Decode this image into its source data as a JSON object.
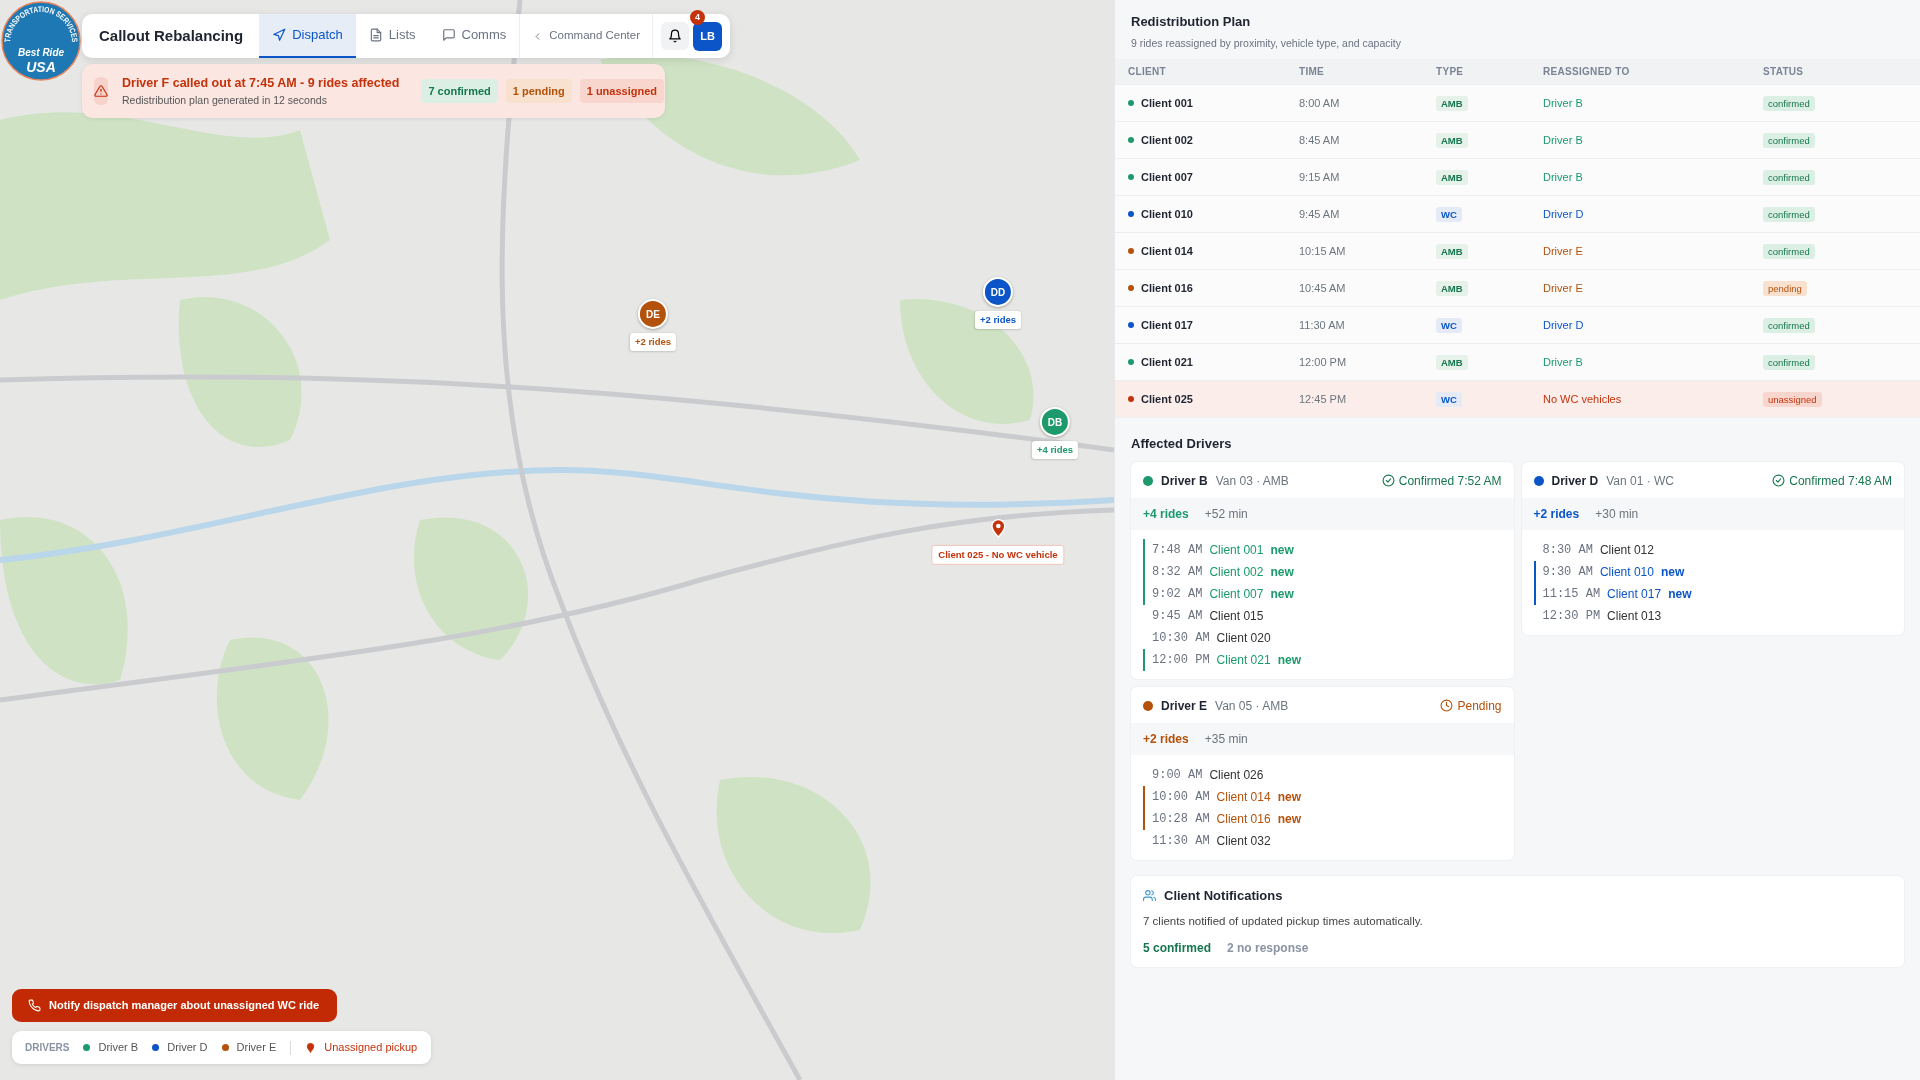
{
  "logo": {
    "arc": "TRANSPORTATION SERVICES",
    "line1": "Best Ride",
    "line2": "USA"
  },
  "header": {
    "title": "Callout Rebalancing",
    "tabs": [
      {
        "label": "Dispatch",
        "selected": true
      },
      {
        "label": "Lists",
        "selected": false
      },
      {
        "label": "Comms",
        "selected": false
      }
    ],
    "back_link": "Command Center",
    "notification_count": "4",
    "user_initials": "LB"
  },
  "alert": {
    "title": "Driver F called out at 7:45 AM - 9 rides affected",
    "subtitle": "Redistribution plan generated in 12 seconds",
    "badges": [
      {
        "label": "7 confirmed",
        "kind": "confirmed"
      },
      {
        "label": "1 pending",
        "kind": "pending"
      },
      {
        "label": "1 unassigned",
        "kind": "unassigned"
      }
    ]
  },
  "map": {
    "drivers": [
      {
        "initials": "DE",
        "label": "+2 rides",
        "color": "#b4510b"
      },
      {
        "initials": "DD",
        "label": "+2 rides",
        "color": "#0b55c9"
      },
      {
        "initials": "DB",
        "label": "+4 rides",
        "color": "#1c9a6c"
      }
    ],
    "unassigned_pin": {
      "label": "Client 025 - No WC vehicle"
    }
  },
  "notify_button": {
    "label": "Notify dispatch manager about unassigned WC ride"
  },
  "legend": {
    "title": "DRIVERS",
    "items": [
      {
        "label": "Driver B",
        "color": "#1c9a6c"
      },
      {
        "label": "Driver D",
        "color": "#0b55c9"
      },
      {
        "label": "Driver E",
        "color": "#b4510b"
      }
    ],
    "unassigned": "Unassigned pickup"
  },
  "plan": {
    "title": "Redistribution Plan",
    "subtitle": "9 rides reassigned by proximity, vehicle type, and capacity",
    "columns": [
      "CLIENT",
      "TIME",
      "TYPE",
      "REASSIGNED TO",
      "STATUS"
    ],
    "rows": [
      {
        "client": "Client 001",
        "time": "8:00 AM",
        "type": {
          "label": "AMB",
          "kind": "amb"
        },
        "reassigned_to": "Driver B",
        "status": "confirmed",
        "kind": "confirmed",
        "color": "#1c9a6c"
      },
      {
        "client": "Client 002",
        "time": "8:45 AM",
        "type": {
          "label": "AMB",
          "kind": "amb"
        },
        "reassigned_to": "Driver B",
        "status": "confirmed",
        "kind": "confirmed",
        "color": "#1c9a6c"
      },
      {
        "client": "Client 007",
        "time": "9:15 AM",
        "type": {
          "label": "AMB",
          "kind": "amb"
        },
        "reassigned_to": "Driver B",
        "status": "confirmed",
        "kind": "confirmed",
        "color": "#1c9a6c"
      },
      {
        "client": "Client 010",
        "time": "9:45 AM",
        "type": {
          "label": "WC",
          "kind": "wc"
        },
        "reassigned_to": "Driver D",
        "status": "confirmed",
        "kind": "confirmed",
        "color": "#0b55c9"
      },
      {
        "client": "Client 014",
        "time": "10:15 AM",
        "type": {
          "label": "AMB",
          "kind": "amb"
        },
        "reassigned_to": "Driver E",
        "status": "confirmed",
        "kind": "confirmed",
        "color": "#b4510b"
      },
      {
        "client": "Client 016",
        "time": "10:45 AM",
        "type": {
          "label": "AMB",
          "kind": "amb"
        },
        "reassigned_to": "Driver E",
        "status": "pending",
        "kind": "pending",
        "color": "#b4510b"
      },
      {
        "client": "Client 017",
        "time": "11:30 AM",
        "type": {
          "label": "WC",
          "kind": "wc"
        },
        "reassigned_to": "Driver D",
        "status": "confirmed",
        "kind": "confirmed",
        "color": "#0b55c9"
      },
      {
        "client": "Client 021",
        "time": "12:00 PM",
        "type": {
          "label": "AMB",
          "kind": "amb"
        },
        "reassigned_to": "Driver B",
        "status": "confirmed",
        "kind": "confirmed",
        "color": "#1c9a6c"
      },
      {
        "client": "Client 025",
        "time": "12:45 PM",
        "type": {
          "label": "WC",
          "kind": "wc"
        },
        "reassigned_to": "No WC vehicles",
        "status": "unassigned",
        "kind": "unassigned",
        "color": "#c4320c"
      }
    ]
  },
  "affected": {
    "title": "Affected Drivers",
    "drivers": [
      {
        "name": "Driver B",
        "vehicle": "Van 03 · AMB",
        "color": "#1c9a6c",
        "status": {
          "label": "Confirmed 7:52 AM",
          "kind": "confirmed"
        },
        "rides": "+4 rides",
        "extra": "+52 min",
        "schedule": [
          {
            "time": "7:48 AM",
            "client": "Client 001",
            "tag": "new"
          },
          {
            "time": "8:32 AM",
            "client": "Client 002",
            "tag": "new"
          },
          {
            "time": "9:02 AM",
            "client": "Client 007",
            "tag": "new"
          },
          {
            "time": "9:45 AM",
            "client": "Client 015"
          },
          {
            "time": "10:30 AM",
            "client": "Client 020"
          },
          {
            "time": "12:00 PM",
            "client": "Client 021",
            "tag": "new"
          }
        ]
      },
      {
        "name": "Driver D",
        "vehicle": "Van 01 · WC",
        "color": "#0b55c9",
        "status": {
          "label": "Confirmed 7:48 AM",
          "kind": "confirmed"
        },
        "rides": "+2 rides",
        "extra": "+30 min",
        "schedule": [
          {
            "time": "8:30 AM",
            "client": "Client 012"
          },
          {
            "time": "9:30 AM",
            "client": "Client 010",
            "tag": "new"
          },
          {
            "time": "11:15 AM",
            "client": "Client 017",
            "tag": "new"
          },
          {
            "time": "12:30 PM",
            "client": "Client 013"
          }
        ]
      },
      {
        "name": "Driver E",
        "vehicle": "Van 05 · AMB",
        "color": "#b4510b",
        "status": {
          "label": "Pending",
          "kind": "pending"
        },
        "rides": "+2 rides",
        "extra": "+35 min",
        "schedule": [
          {
            "time": "9:00 AM",
            "client": "Client 026"
          },
          {
            "time": "10:00 AM",
            "client": "Client 014",
            "tag": "new"
          },
          {
            "time": "10:28 AM",
            "client": "Client 016",
            "tag": "new"
          },
          {
            "time": "11:30 AM",
            "client": "Client 032"
          }
        ]
      }
    ]
  },
  "notifications": {
    "title": "Client Notifications",
    "text": "7 clients notified of updated pickup times automatically.",
    "confirmed": "5 confirmed",
    "no_response": "2 no response"
  }
}
